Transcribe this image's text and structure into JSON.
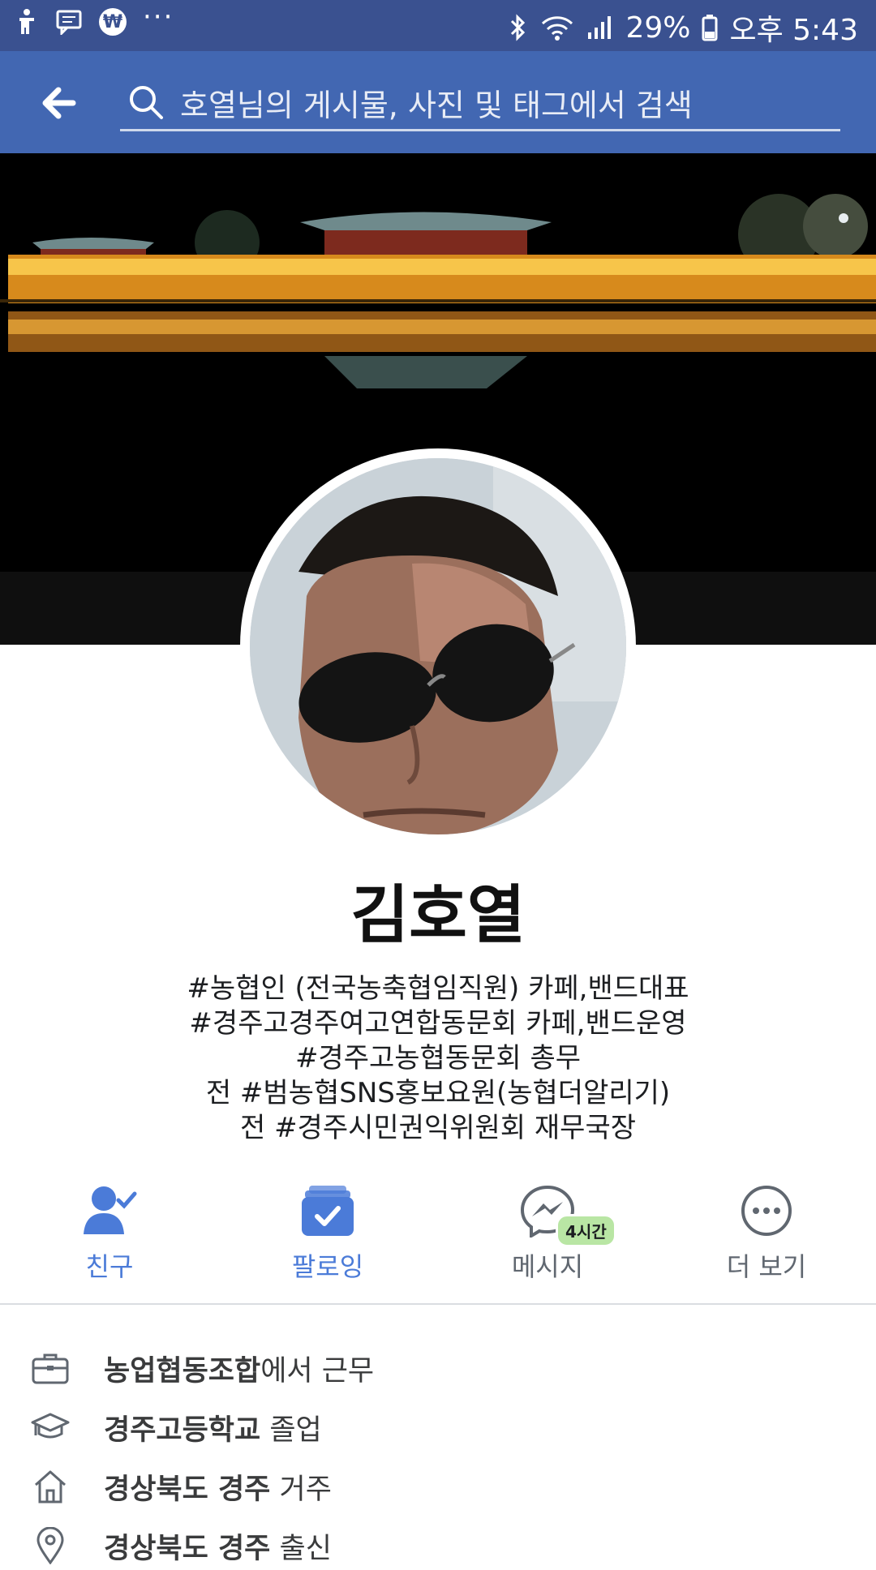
{
  "status_bar": {
    "battery": "29%",
    "time": "오후 5:43",
    "icons_left": [
      "accessibility-icon",
      "message-icon",
      "won-icon",
      "more-dots-icon"
    ],
    "icons_right": [
      "bluetooth-icon",
      "wifi-icon",
      "signal-icon",
      "battery-icon"
    ]
  },
  "header": {
    "search_placeholder": "호열님의 게시물, 사진 및 태그에서 검색",
    "color": "#4267b2"
  },
  "profile": {
    "name": "김호열",
    "bio": [
      "#농협인 (전국농축협임직원) 카페,밴드대표",
      "#경주고경주여고연합동문회 카페,밴드운영",
      "#경주고농협동문회 총무",
      "전 #범농협SNS홍보요원(농협더알리기)",
      "전 #경주시민권익위원회 재무국장"
    ]
  },
  "actions": {
    "friends": "친구",
    "following": "팔로잉",
    "message": "메시지",
    "message_badge": "4시간",
    "more": "더 보기",
    "accent": "#4b7bd8"
  },
  "info": {
    "work": {
      "strong": "농업협동조합",
      "rest": "에서 근무"
    },
    "education": {
      "strong": "경주고등학교",
      "rest": " 졸업"
    },
    "lives": {
      "strong": "경상북도 경주",
      "rest": " 거주"
    },
    "from": {
      "strong": "경상북도 경주",
      "rest": " 출신"
    }
  }
}
